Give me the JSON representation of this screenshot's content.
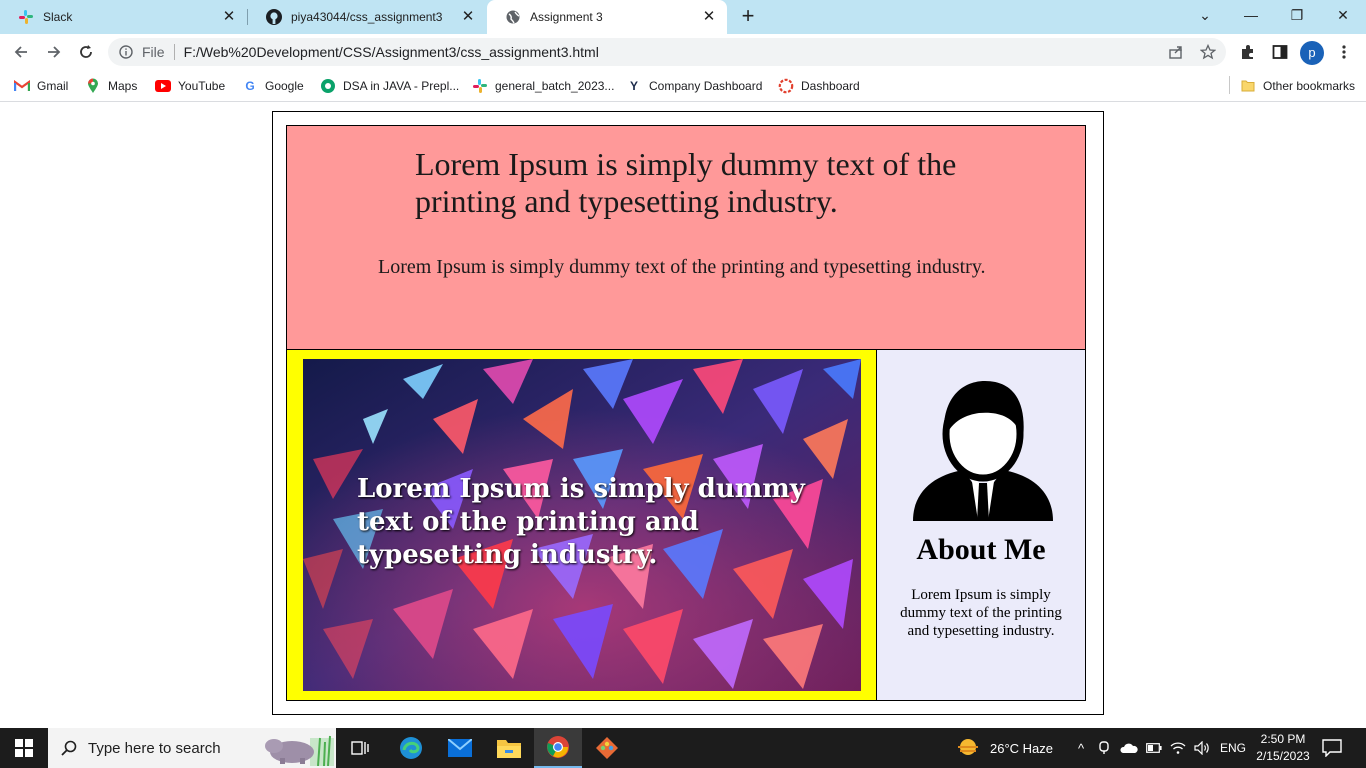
{
  "tabs": [
    {
      "title": "Slack",
      "icon": "slack-icon"
    },
    {
      "title": "piya43044/css_assignment3",
      "icon": "github-icon"
    },
    {
      "title": "Assignment 3",
      "icon": "globe-icon"
    }
  ],
  "omnibox": {
    "scheme_label": "File",
    "url": "F:/Web%20Development/CSS/Assignment3/css_assignment3.html"
  },
  "profile_initial": "p",
  "bookmarks": [
    {
      "label": "Gmail",
      "icon": "gmail-icon"
    },
    {
      "label": "Maps",
      "icon": "maps-icon"
    },
    {
      "label": "YouTube",
      "icon": "youtube-icon"
    },
    {
      "label": "Google",
      "icon": "google-icon"
    },
    {
      "label": "DSA in JAVA - Prepl...",
      "icon": "prepl-icon"
    },
    {
      "label": "general_batch_2023...",
      "icon": "slack-icon"
    },
    {
      "label": "Company Dashboard",
      "icon": "y-icon"
    },
    {
      "label": "Dashboard",
      "icon": "dashboard-icon"
    },
    {
      "label": "Other bookmarks",
      "icon": "folder-icon"
    }
  ],
  "page": {
    "header_title": "Lorem Ipsum is simply dummy text of the printing and typesetting industry.",
    "header_text": "Lorem Ipsum is simply dummy text of the printing and typesetting industry.",
    "hero_text": "Lorem Ipsum is simply dummy text of the printing and typesetting industry.",
    "about_title": "About Me",
    "about_text": "Lorem Ipsum is simply dummy text of the printing and typesetting industry.",
    "colors": {
      "header_bg": "#ff9999",
      "left_bg": "#ffff00",
      "right_bg": "#ebebfa"
    }
  },
  "taskbar": {
    "search_placeholder": "Type here to search",
    "weather": "26°C  Haze",
    "language": "ENG",
    "time": "2:50 PM",
    "date": "2/15/2023"
  }
}
